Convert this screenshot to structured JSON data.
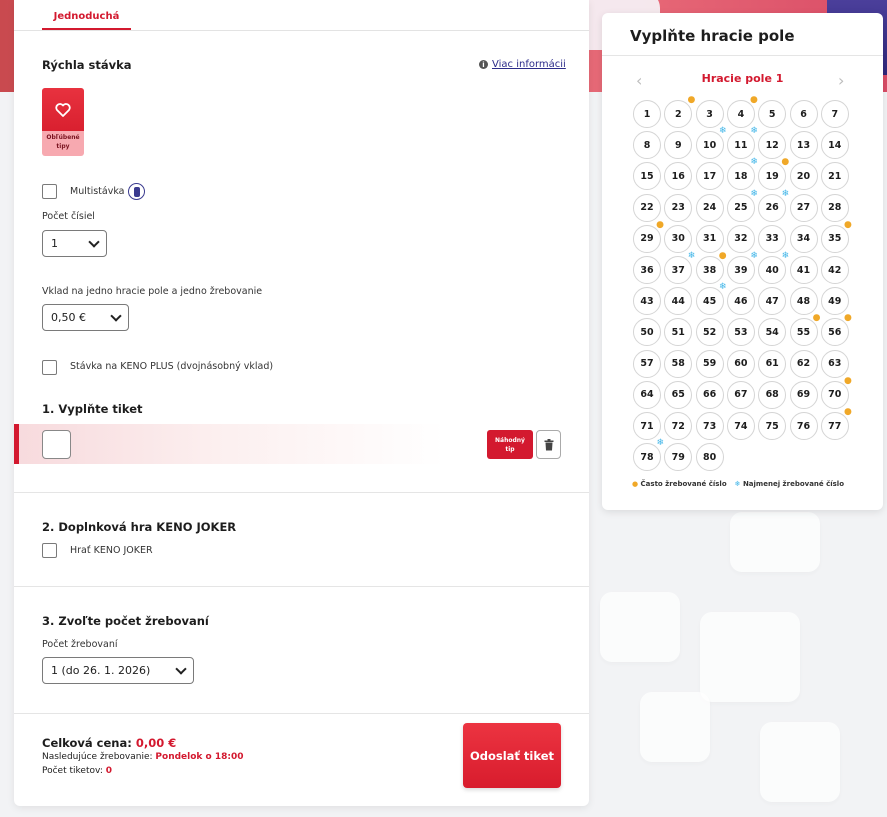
{
  "tabs": {
    "active": "Jednoduchá"
  },
  "quick_bet": {
    "title": "Rýchla stávka",
    "info_link": "Viac informácii",
    "favourite_label_line1": "Obľúbené",
    "favourite_label_line2": "tipy"
  },
  "multibet": {
    "label": "Multistávka"
  },
  "numbers_count": {
    "label": "Počet čísiel",
    "value": "1"
  },
  "stake": {
    "label": "Vklad na jedno hracie pole a jedno žrebovanie",
    "value": "0,50 €"
  },
  "keno_plus": {
    "label": "Stávka na KENO PLUS (dvojnásobný vklad)"
  },
  "step1": {
    "title": "1. Vyplňte tiket",
    "random_line1": "Náhodný",
    "random_line2": "tip"
  },
  "step2": {
    "title": "2. Doplnková hra KENO JOKER",
    "checkbox_label": "Hrať KENO JOKER"
  },
  "step3": {
    "title": "3. Zvoľte počet žrebovaní",
    "label": "Počet žrebovaní",
    "value": "1 (do 26. 1. 2026)"
  },
  "summary": {
    "total_label": "Celková cena:",
    "total_value": "0,00 €",
    "next_draw_label": "Nasledujúce žrebovanie:",
    "next_draw_value": "Pondelok o 18:00",
    "tickets_label": "Počet tiketov:",
    "tickets_value": "0",
    "submit": "Odoslať tiket"
  },
  "board": {
    "title": "Vyplňte hracie pole",
    "subtitle": "Hracie pole 1",
    "prev": "‹",
    "next": "›",
    "hot_numbers": [
      2,
      4,
      19,
      29,
      35,
      38,
      55,
      56,
      70,
      77
    ],
    "cold_numbers": [
      10,
      11,
      18,
      25,
      26,
      37,
      39,
      40,
      45,
      78
    ],
    "legend_hot": "Často žrebované číslo",
    "legend_cold": "Najmenej žrebované číslo",
    "colors": {
      "hot": "#f0a828",
      "cold": "#3fb5e8",
      "accent": "#d3192f"
    }
  }
}
